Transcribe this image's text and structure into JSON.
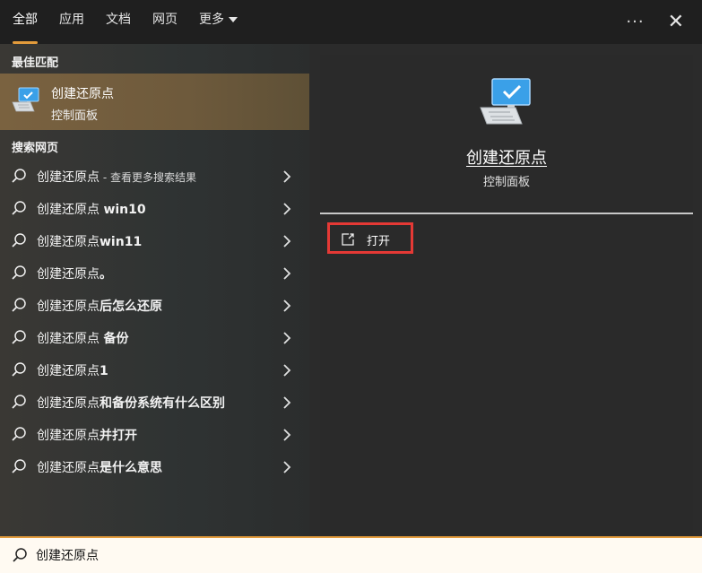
{
  "tabs": [
    {
      "label": "全部",
      "active": true
    },
    {
      "label": "应用",
      "active": false
    },
    {
      "label": "文档",
      "active": false
    },
    {
      "label": "网页",
      "active": false
    },
    {
      "label": "更多",
      "active": false
    }
  ],
  "topbar": {
    "more_icon": "more-dots-icon",
    "close_icon": "close-icon",
    "more_glyph": "···",
    "close_glyph": "✕"
  },
  "best_match": {
    "section_title": "最佳匹配",
    "title": "创建还原点",
    "subtitle": "控制面板",
    "icon": "computer-check-icon"
  },
  "web_search": {
    "section_title": "搜索网页",
    "items": [
      {
        "prefix": "创建还原点",
        "suffix": " - 查看更多搜索结果"
      },
      {
        "prefix": "创建还原点 ",
        "suffix": "win10"
      },
      {
        "prefix": "创建还原点",
        "suffix": "win11"
      },
      {
        "prefix": "创建还原点",
        "suffix": "。"
      },
      {
        "prefix": "创建还原点",
        "suffix": "后怎么还原"
      },
      {
        "prefix": "创建还原点 ",
        "suffix": "备份"
      },
      {
        "prefix": "创建还原点",
        "suffix": "1"
      },
      {
        "prefix": "创建还原点",
        "suffix": "和备份系统有什么区别"
      },
      {
        "prefix": "创建还原点",
        "suffix": "并打开"
      },
      {
        "prefix": "创建还原点",
        "suffix": "是什么意思"
      }
    ]
  },
  "detail": {
    "title": "创建还原点",
    "subtitle": "控制面板",
    "open_label": "打开",
    "open_icon": "open-external-icon",
    "highlight_color": "#e53935"
  },
  "search": {
    "value": "创建还原点",
    "icon": "search-icon"
  },
  "colors": {
    "accent": "#e39b3b",
    "best_match_bg": "#7a6240"
  }
}
